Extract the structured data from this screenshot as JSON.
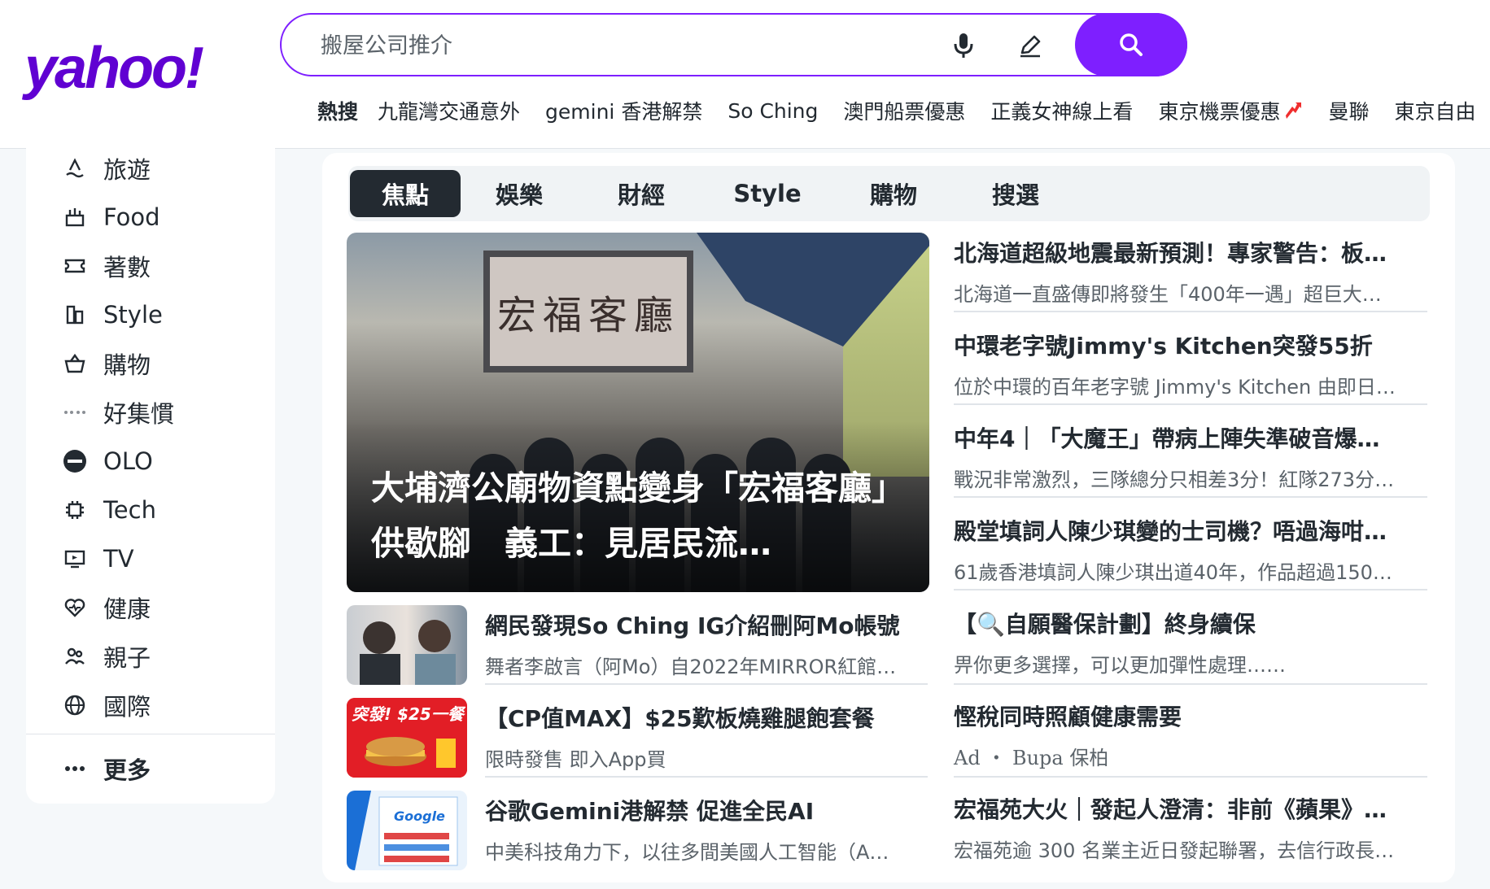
{
  "header": {
    "logo": "yahoo!",
    "search": {
      "placeholder": "搬屋公司推介"
    },
    "trending": {
      "label": "熱搜",
      "items": [
        "九龍灣交通意外",
        "gemini 香港解禁",
        "So Ching",
        "澳門船票優惠",
        "正義女神線上看",
        "東京機票優惠",
        "曼聯",
        "東京自由"
      ]
    }
  },
  "sidebar": {
    "items": [
      {
        "label": "旅遊",
        "icon": "travel-icon"
      },
      {
        "label": "Food",
        "icon": "food-icon"
      },
      {
        "label": "著數",
        "icon": "coupon-icon"
      },
      {
        "label": "Style",
        "icon": "style-icon"
      },
      {
        "label": "購物",
        "icon": "shopping-basket-icon"
      },
      {
        "label": "好集慣",
        "icon": "brand-logo-icon"
      },
      {
        "label": "OLO",
        "icon": "olo-live-icon"
      },
      {
        "label": "Tech",
        "icon": "chip-icon"
      },
      {
        "label": "TV",
        "icon": "tv-icon"
      },
      {
        "label": "健康",
        "icon": "heart-pulse-icon"
      },
      {
        "label": "親子",
        "icon": "family-icon"
      },
      {
        "label": "國際",
        "icon": "globe-icon"
      }
    ],
    "more": "更多"
  },
  "tabs": [
    "焦點",
    "娛樂",
    "財經",
    "Style",
    "購物",
    "搜選"
  ],
  "hero": {
    "title": "大埔濟公廟物資點變身「宏福客廳」供歇腳　義工：見居民流…",
    "sign_text": "宏福客廳"
  },
  "right_articles": [
    {
      "title": "北海道超級地震最新預測！專家警告：板…",
      "summary": "北海道一直盛傳即將發生「400年一遇」超巨大…"
    },
    {
      "title": "中環老字號Jimmy's Kitchen突發55折",
      "summary": "位於中環的百年老字號 Jimmy's Kitchen 由即日…"
    },
    {
      "title": "中年4｜「大魔王」帶病上陣失準破音爆…",
      "summary": "戰況非常激烈，三隊總分只相差3分！紅隊273分…"
    },
    {
      "title": "殿堂填詞人陳少琪變的士司機？唔過海咁…",
      "summary": "61歲香港填詞人陳少琪出道40年，作品超過150…"
    },
    {
      "title": "【🔍自願醫保計劃】終身續保",
      "summary": "畀你更多選擇，可以更加彈性處理……"
    },
    {
      "title": "慳稅同時照顧健康需要",
      "summary": "Ad ・ Bupa 保柏"
    },
    {
      "title": "宏福苑大火｜發起人澄清：非前《蘋果》…",
      "summary": "宏福苑逾 300 名業主近日發起聯署，去信行政長…"
    }
  ],
  "left_articles": [
    {
      "title": "網民發現So Ching IG介紹刪阿Mo帳號",
      "summary": "舞者李啟言（阿Mo）自2022年MIRROR紅館…"
    },
    {
      "title": "【CP值MAX】$25歎板燒雞腿飽套餐",
      "summary": "限時發售 即入App買",
      "thumb_text": "突發! $25一餐"
    },
    {
      "title": "谷歌Gemini港解禁 促進全民AI",
      "summary": "中美科技角力下，以往多間美國人工智能（A…",
      "thumb_text": "Google"
    }
  ],
  "colors": {
    "brand": "#6001d2",
    "accent": "#7e1fff",
    "text": "#232a31",
    "muted": "#5b636a",
    "trend_up": "#f02e2e"
  }
}
